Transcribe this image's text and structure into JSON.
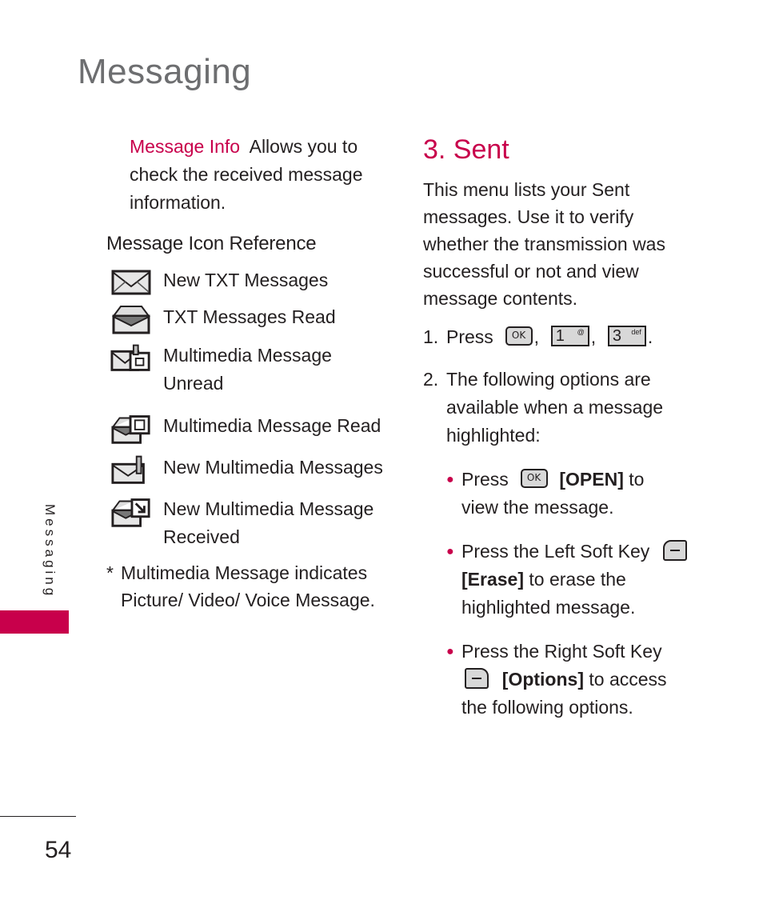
{
  "page": {
    "title": "Messaging",
    "side_tab": "Messaging",
    "page_number": "54",
    "accent_color": "#c8004b"
  },
  "left_column": {
    "message_info": {
      "term": "Message Info",
      "description": "Allows you to check the received message information."
    },
    "icon_reference": {
      "heading": "Message Icon Reference",
      "items": [
        {
          "icon": "envelope-closed-icon",
          "label": "New TXT Messages"
        },
        {
          "icon": "envelope-open-icon",
          "label": "TXT Messages Read"
        },
        {
          "icon": "multimedia-unread-icon",
          "label": "Multimedia Message Unread"
        },
        {
          "icon": "multimedia-read-icon",
          "label": "Multimedia Message Read"
        },
        {
          "icon": "new-multimedia-icon",
          "label": "New Multimedia Messages"
        },
        {
          "icon": "multimedia-received-icon",
          "label": "New Multimedia Message Received"
        }
      ],
      "footnote_marker": "*",
      "footnote": "Multimedia Message indicates Picture/ Video/ Voice Message."
    }
  },
  "right_column": {
    "heading": "3. Sent",
    "intro": "This menu lists your Sent messages. Use it to verify whether the transmission was successful or not and view message contents.",
    "step1": {
      "num": "1.",
      "text": "Press",
      "keys": [
        {
          "icon": "ok-key-icon",
          "label": "OK"
        },
        {
          "icon": "key-1-icon",
          "label": "1",
          "sub": "@"
        },
        {
          "icon": "key-3-icon",
          "label": "3",
          "sub": "def"
        }
      ],
      "sep": ",",
      "end": "."
    },
    "step2": {
      "num": "2.",
      "text": "The following options are available when a message highlighted:"
    },
    "bullets": [
      {
        "pre": "Press",
        "key": "OK",
        "bold": "[OPEN]",
        "post": "to view the message."
      },
      {
        "pre": "Press the Left Soft Key",
        "bold": "[Erase]",
        "post": "to erase the highlighted message."
      },
      {
        "pre": "Press the Right Soft Key",
        "bold": "[Options]",
        "post": "to access the following options."
      }
    ],
    "bullet_glyph": "●"
  }
}
